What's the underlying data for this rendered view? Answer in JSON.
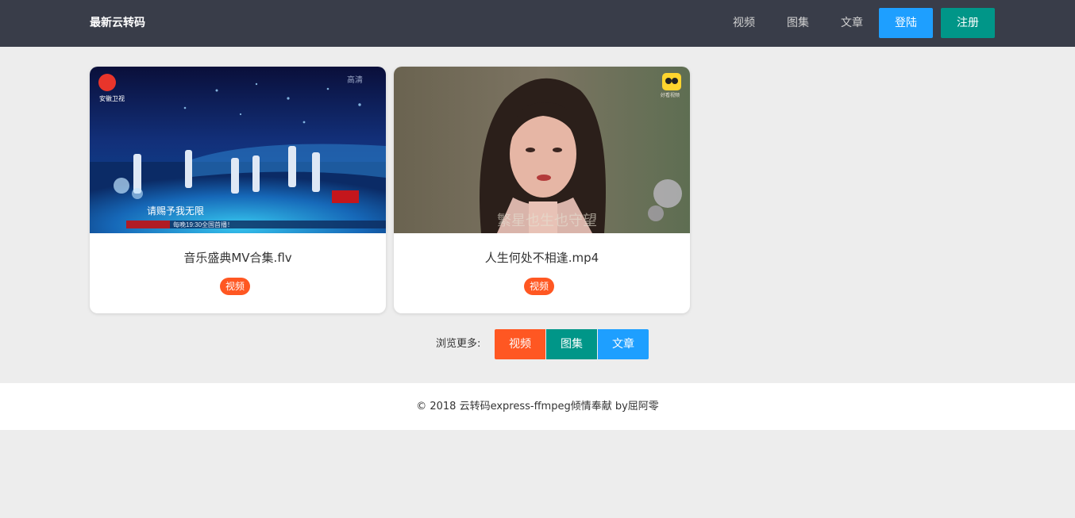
{
  "header": {
    "brand": "最新云转码",
    "nav": [
      "视频",
      "图集",
      "文章"
    ],
    "login_label": "登陆",
    "register_label": "注册"
  },
  "cards": [
    {
      "title": "音乐盛典MV合集.flv",
      "tag": "视频",
      "thumb_text": {
        "logo_text": "安徽卫视",
        "hd_text": "高清",
        "subtitle": "请赐予我无限",
        "ticker": "每晚19:30全国首播！"
      }
    },
    {
      "title": "人生何处不相逢.mp4",
      "tag": "视频",
      "thumb_text": {
        "watermark": "好看视频",
        "subtitle": "繁星也生也守望"
      }
    }
  ],
  "browse_more": {
    "label": "浏览更多:",
    "buttons": [
      "视频",
      "图集",
      "文章"
    ]
  },
  "footer": {
    "text": "© 2018 云转码express-ffmpeg倾情奉献 by屈阿零"
  },
  "colors": {
    "header_bg": "#393d49",
    "login_blue": "#1e9fff",
    "register_green": "#009688",
    "tag_orange": "#ff5722",
    "video_orange": "#ff5722",
    "gallery_green": "#009688",
    "article_blue": "#1e9fff"
  }
}
